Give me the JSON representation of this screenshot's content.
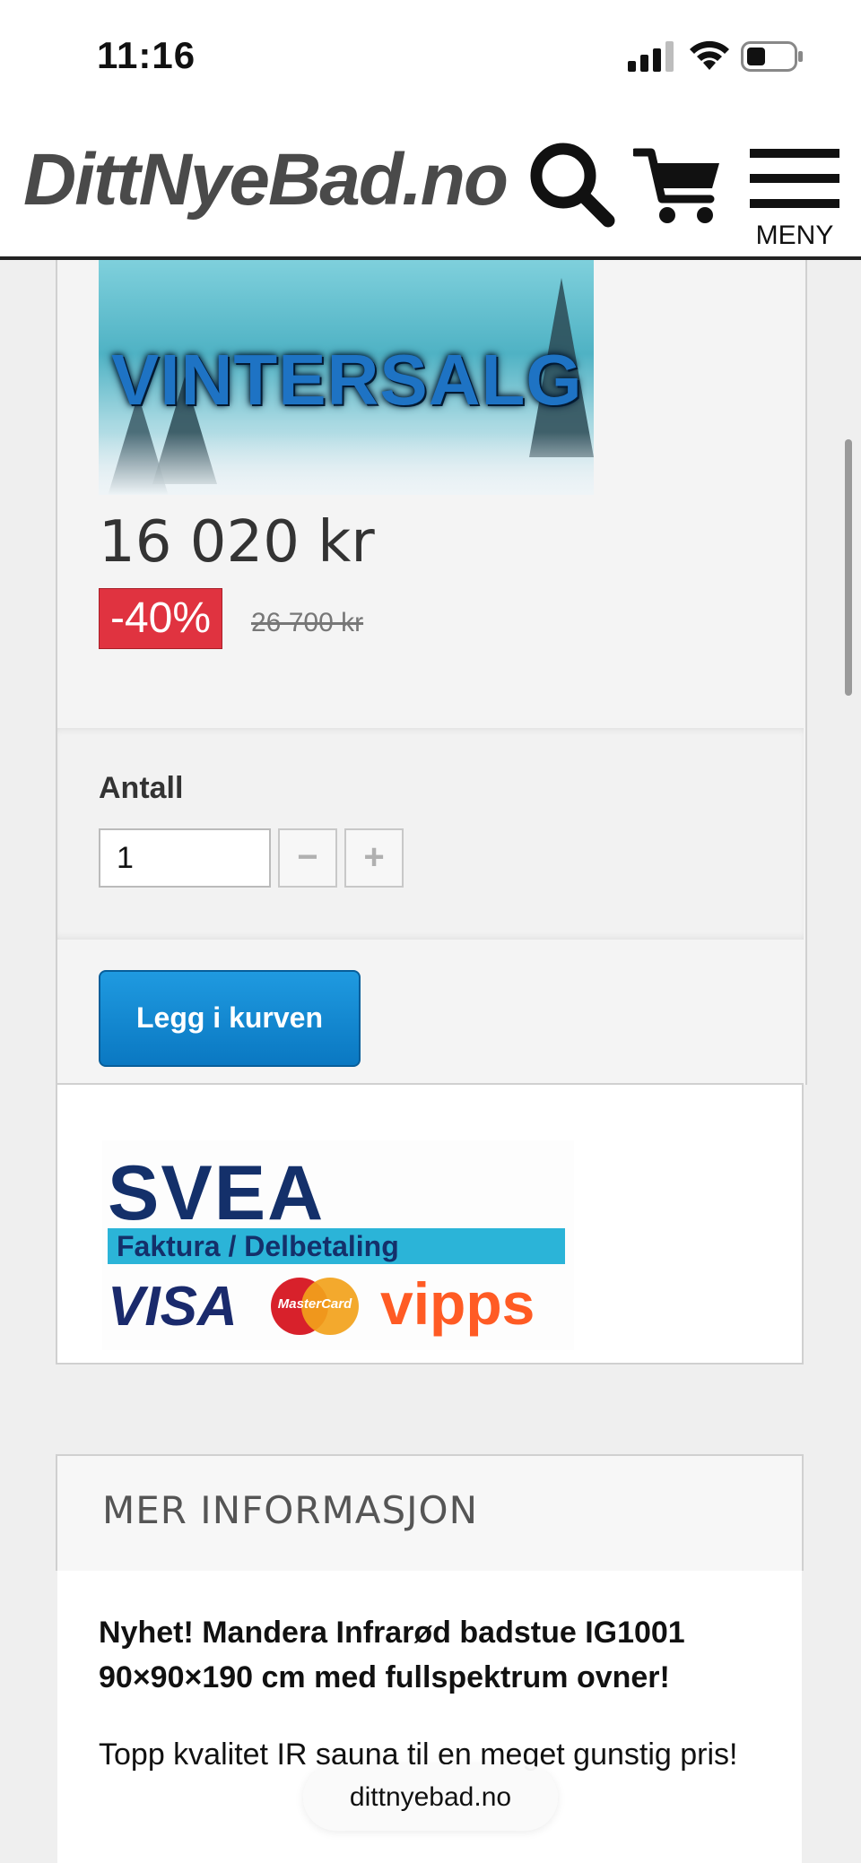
{
  "status_bar": {
    "time": "11:16"
  },
  "header": {
    "logo": "DittNyeBad.no",
    "menu_label": "MENY"
  },
  "product": {
    "banner_text": "VINTERSALG",
    "price": "16 020 kr",
    "discount": "-40%",
    "old_price": "26 700 kr",
    "quantity_label": "Antall",
    "quantity_value": "1",
    "minus_symbol": "−",
    "plus_symbol": "+",
    "add_to_cart_label": "Legg i kurven"
  },
  "payment": {
    "brand": "SVEA",
    "subtitle": "Faktura / Delbetaling",
    "visa": "VISA",
    "mastercard": "MasterCard",
    "vipps": "vipps"
  },
  "info": {
    "title": "MER INFORMASJON",
    "headline": "Nyhet! Mandera Infrarød badstue IG1001 90×90×190 cm med fullspektrum ovner!",
    "text": "Topp kvalitet IR sauna til en meget gunstig pris!"
  },
  "browser": {
    "url": "dittnyebad.no"
  },
  "colors": {
    "discount": "#e03340",
    "button": "#0a78c2",
    "svea_blue": "#14306a",
    "vipps_orange": "#ff5b24"
  }
}
